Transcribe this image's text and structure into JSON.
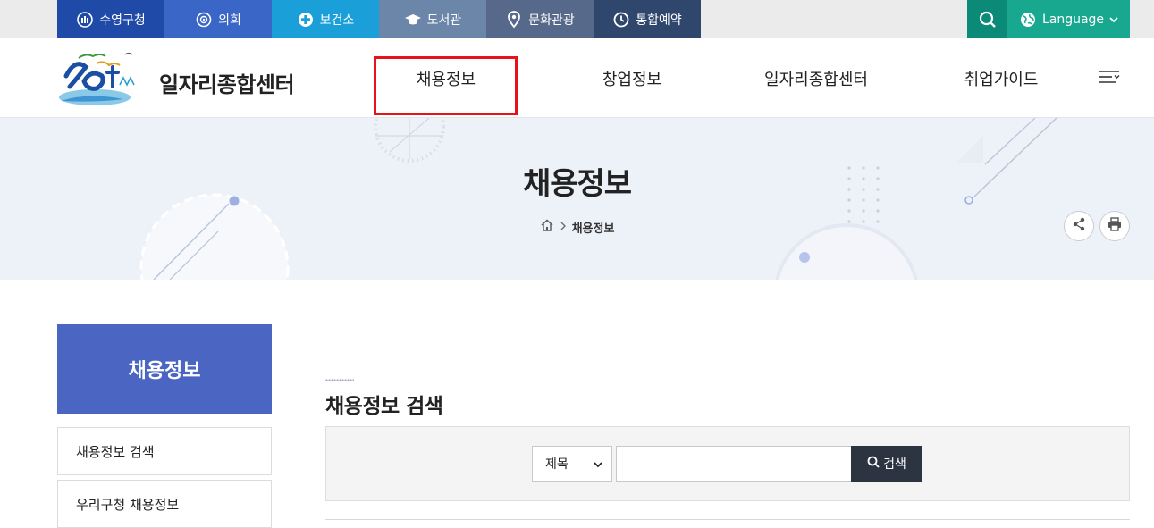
{
  "topbar": {
    "items": [
      {
        "label": "수영구청",
        "icon": "building-icon"
      },
      {
        "label": "의회",
        "icon": "emblem-icon"
      },
      {
        "label": "보건소",
        "icon": "medical-cross-icon"
      },
      {
        "label": "도서관",
        "icon": "graduation-cap-icon"
      },
      {
        "label": "문화관광",
        "icon": "map-pin-icon"
      },
      {
        "label": "통합예약",
        "icon": "clock-icon"
      }
    ],
    "search_icon": "search-icon",
    "language_label": "Language"
  },
  "header": {
    "site_title": "일자리종합센터",
    "logo_alt": "수영구 logo",
    "nav": [
      {
        "label": "채용정보"
      },
      {
        "label": "창업정보"
      },
      {
        "label": "일자리종합센터"
      },
      {
        "label": "취업가이드"
      }
    ]
  },
  "banner": {
    "title": "채용정보",
    "breadcrumb_current": "채용정보"
  },
  "sidebar": {
    "title": "채용정보",
    "items": [
      {
        "label": "채용정보 검색"
      },
      {
        "label": "우리구청 채용정보"
      }
    ]
  },
  "content": {
    "title": "채용정보 검색",
    "search": {
      "select_value": "제목",
      "input_value": "",
      "button_label": "검색"
    }
  },
  "colors": {
    "accent_blue": "#4a66c2",
    "highlight_red": "#e8121b",
    "teal": "#18a78f"
  }
}
